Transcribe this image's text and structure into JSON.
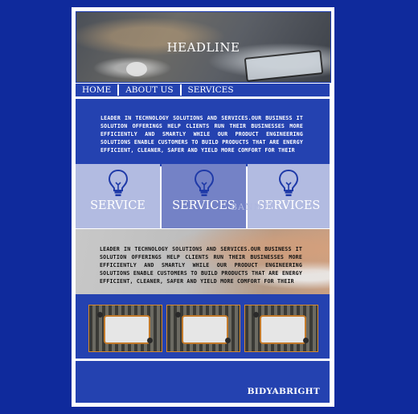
{
  "header": {
    "headline": "HEADLINE"
  },
  "nav": {
    "items": [
      "HOME",
      "ABOUT US",
      "SERVICES"
    ]
  },
  "intro": {
    "text": "LEADER IN TECHNOLOGY SOLUTIONS AND SERVICES.OUR BUSINESS IT SOLUTION OFFERINGS HELP CLIENTS RUN THEIR BUSINESSES MORE EFFICIENTLY AND SMARTLY WHILE OUR PRODUCT ENGINEERING SOLUTIONS ENABLE CUSTOMERS TO BUILD PRODUCTS THAT ARE ENERGY EFFICIENT, CLEANER, SAFER AND YIELD MORE COMFORT FOR THEIR"
  },
  "services": {
    "cards": [
      {
        "label": "SERVICE",
        "icon": "lightbulb-icon"
      },
      {
        "label": "SERVICES",
        "icon": "lightbulb-icon"
      },
      {
        "label": "SERVICES",
        "icon": "lightbulb-icon"
      }
    ],
    "ghost_text": "BANNER"
  },
  "about": {
    "text": "LEADER IN TECHNOLOGY SOLUTIONS AND SERVICES.OUR BUSINESS IT SOLUTION OFFERINGS HELP CLIENTS RUN THEIR BUSINESSES MORE EFFICIENTLY AND SMARTLY WHILE OUR PRODUCT ENGINEERING SOLUTIONS ENABLE CUSTOMERS TO BUILD PRODUCTS THAT ARE ENERGY EFFICIENT, CLEANER, SAFER AND YIELD MORE COMFORT FOR THEIR"
  },
  "gallery": {
    "thumbs": [
      "meeting-photo",
      "meeting-photo",
      "meeting-photo"
    ]
  },
  "footer": {
    "brand": "BIDYABRIGHT"
  },
  "colors": {
    "page_bg": "#0f2a9c",
    "panel_blue": "#2442b0",
    "card_light": "#b2bbe1",
    "card_mid": "#7482c6"
  }
}
